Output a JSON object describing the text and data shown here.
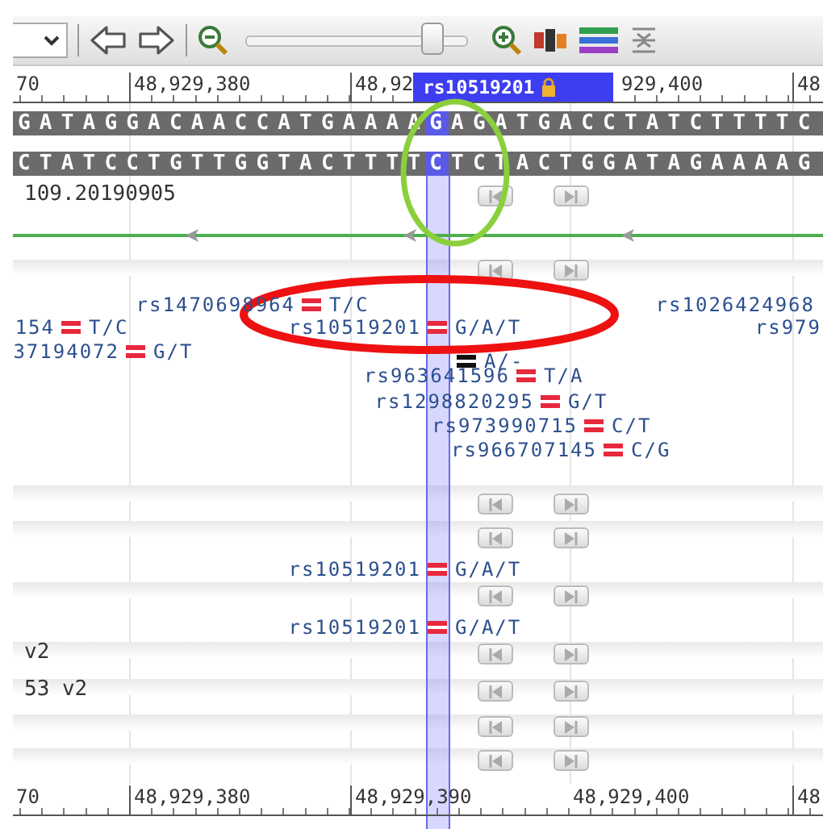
{
  "toolbar": {
    "zoom_slider": {
      "level": 0.8
    }
  },
  "ruler_top": {
    "labels": [
      "70",
      "48,929,380",
      "48,92",
      "929,400",
      "48"
    ]
  },
  "selection": {
    "label": "rs10519201",
    "locked": true
  },
  "sequence": {
    "forward": "GATAGGACAACCATGAAAAGAGATGACCTATCTTTTC",
    "reverse": "CTATCCTGTTGGTACTTTTCTCTACTGGATAGAAAAG"
  },
  "track_rows": [
    {
      "kind": "nav",
      "label": "109.20190905"
    },
    {
      "kind": "nav"
    },
    {
      "kind": "nav"
    },
    {
      "kind": "nav"
    },
    {
      "kind": "nav"
    },
    {
      "kind": "nav",
      "label": "v2"
    },
    {
      "kind": "nav",
      "label": "53 v2"
    },
    {
      "kind": "nav"
    },
    {
      "kind": "nav"
    }
  ],
  "variants": [
    {
      "name": "rs1470698964",
      "allele": "T/C",
      "color": "#e8283c"
    },
    {
      "name": "154",
      "allele": "T/C",
      "color": "#e8283c"
    },
    {
      "name": "rs10519201",
      "allele": "G/A/T",
      "color": "#e8283c"
    },
    {
      "name": "rs1026424968"
    },
    {
      "name": "rs979"
    },
    {
      "name": "37194072",
      "allele": "G/T",
      "color": "#e8283c"
    },
    {
      "allele": "A/-",
      "color": "#111111"
    },
    {
      "name": "rs963641596",
      "allele": "T/A",
      "color": "#e8283c"
    },
    {
      "name": "rs1298820295",
      "allele": "G/T",
      "color": "#e8283c"
    },
    {
      "name": "rs973990715",
      "allele": "C/T",
      "color": "#e8283c"
    },
    {
      "name": "rs966707145",
      "allele": "C/G",
      "color": "#e8283c"
    },
    {
      "name": "rs10519201",
      "allele": "G/A/T",
      "color": "#e8283c"
    },
    {
      "name": "rs10519201",
      "allele": "G/A/T",
      "color": "#e8283c"
    }
  ],
  "ruler_bottom": {
    "labels": [
      "70",
      "48,929,380",
      "48,929,390",
      "48,929,400",
      "48"
    ]
  },
  "annotations": [
    {
      "kind": "ellipse",
      "color": "#8ccf3c"
    },
    {
      "kind": "ellipse",
      "color": "#ee1111"
    }
  ]
}
